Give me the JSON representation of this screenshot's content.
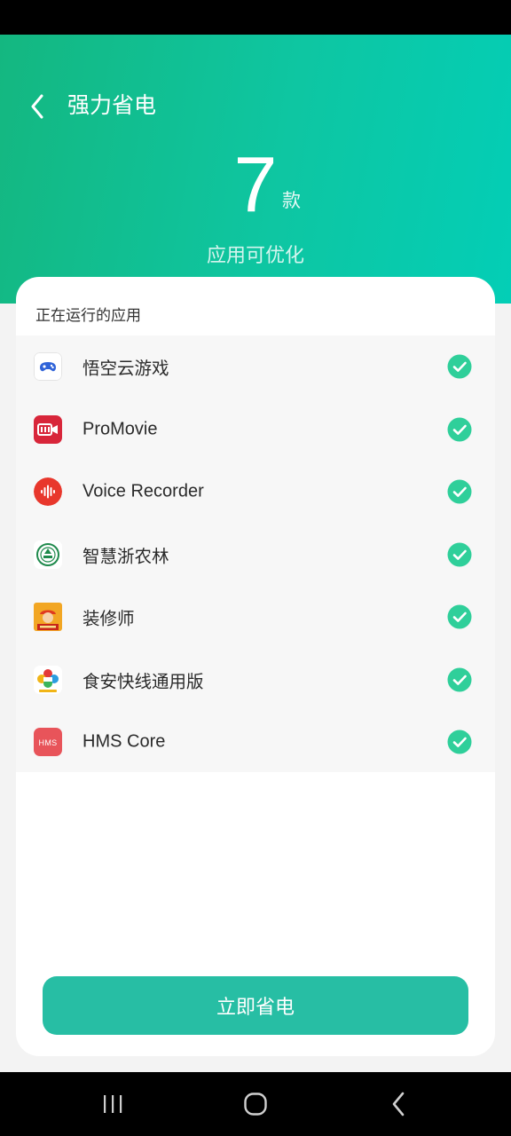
{
  "header": {
    "title": "强力省电",
    "back_icon": "chevron-left-icon",
    "count": "7",
    "count_unit": "款",
    "count_desc": "应用可优化",
    "gradient_colors": [
      "#14b780",
      "#03ceb6"
    ]
  },
  "card": {
    "section_title": "正在运行的应用",
    "apps": [
      {
        "name": "悟空云游戏",
        "icon": "wukong-cloud-game-icon",
        "checked": true
      },
      {
        "name": "ProMovie",
        "icon": "promovie-icon",
        "checked": true
      },
      {
        "name": "Voice Recorder",
        "icon": "voice-recorder-icon",
        "checked": true
      },
      {
        "name": "智慧浙农林",
        "icon": "zhihui-zhenonglin-icon",
        "checked": true
      },
      {
        "name": "装修师",
        "icon": "zhuangxiushi-icon",
        "checked": true
      },
      {
        "name": "食安快线通用版",
        "icon": "shian-kuaixian-icon",
        "checked": true
      },
      {
        "name": "HMS Core",
        "icon": "hms-core-icon",
        "checked": true
      }
    ],
    "check_color": "#2fcf9a",
    "button_label": "立即省电",
    "button_color": "#27bea4"
  },
  "nav_bar": {
    "recents_icon": "recents-icon",
    "home_icon": "home-icon",
    "back_icon": "back-icon"
  }
}
